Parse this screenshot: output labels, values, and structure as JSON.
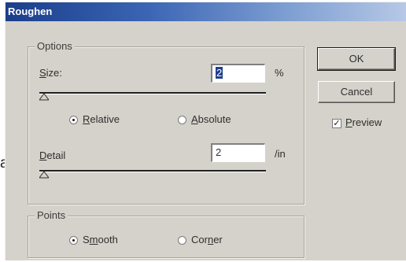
{
  "window": {
    "title": "Roughen"
  },
  "options": {
    "group_label": "Options",
    "size": {
      "label_before": "",
      "label_mnemonic": "S",
      "label_after": "ize:",
      "value": "2",
      "unit": "%"
    },
    "relative": {
      "label_mnemonic": "R",
      "label_after": "elative",
      "checked": true
    },
    "absolute": {
      "label_mnemonic": "A",
      "label_after": "bsolute",
      "checked": false
    },
    "detail": {
      "label_mnemonic": "D",
      "label_after": "etail",
      "value": "2",
      "unit": "/in"
    }
  },
  "points": {
    "group_label": "Points",
    "smooth": {
      "label_before": "S",
      "label_mnemonic": "m",
      "label_after": "ooth",
      "checked": true
    },
    "corner": {
      "label_before": "Cor",
      "label_mnemonic": "n",
      "label_after": "er",
      "checked": false
    }
  },
  "buttons": {
    "ok": "OK",
    "cancel": "Cancel"
  },
  "preview": {
    "label_mnemonic": "P",
    "label_after": "review",
    "checked": true,
    "check_glyph": "✓"
  },
  "stray_text": "a"
}
